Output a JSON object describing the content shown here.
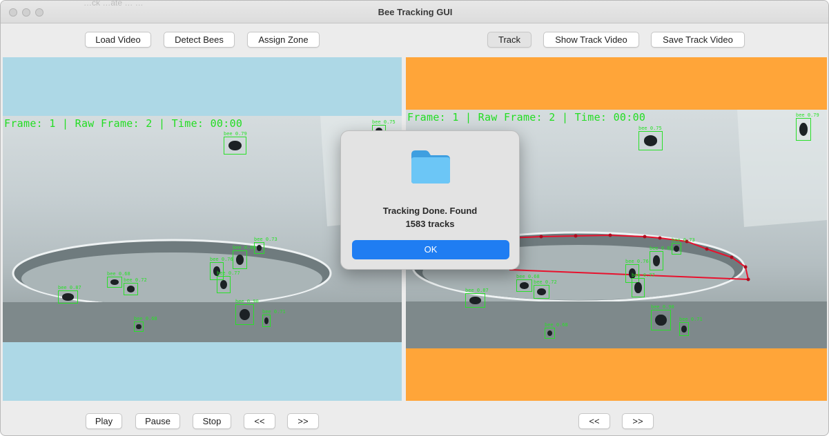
{
  "window": {
    "title": "Bee Tracking GUI",
    "background_text": "…ck                                                      …ate … …"
  },
  "toolbar": {
    "load_video": "Load Video",
    "detect_bees": "Detect Bees",
    "assign_zone": "Assign Zone",
    "track": "Track",
    "show_track_video": "Show Track Video",
    "save_track_video": "Save Track Video"
  },
  "left_panel": {
    "background_color": "#add8e6",
    "overlay": "Frame: 1  |  Raw Frame: 2  |  Time: 00:00",
    "detections": [
      {
        "label": "bee 0.75"
      },
      {
        "label": "bee 0.79"
      },
      {
        "label": "bee 0.73"
      },
      {
        "label": "bee 0.89"
      },
      {
        "label": "bee 0.76"
      },
      {
        "label": "bee 0.77"
      },
      {
        "label": "bee 0.68"
      },
      {
        "label": "bee 0.72"
      },
      {
        "label": "bee 0.87"
      },
      {
        "label": "bee 0.90"
      },
      {
        "label": "bee 0.71"
      },
      {
        "label": "bee 0.68"
      }
    ]
  },
  "right_panel": {
    "background_color": "#ffa539",
    "overlay": "Frame: 1  |  Raw Frame: 2  |  Time: 00:00",
    "detections": [
      {
        "label": "bee 0.79"
      },
      {
        "label": "bee 0.75"
      },
      {
        "label": "bee 0.89"
      },
      {
        "label": "bee 0.73"
      },
      {
        "label": "bee 0.76"
      },
      {
        "label": "bee 0.77"
      },
      {
        "label": "bee 0.68"
      },
      {
        "label": "bee 0.72"
      },
      {
        "label": "bee 0.87"
      },
      {
        "label": "bee 0.90"
      },
      {
        "label": "bee 0.71"
      },
      {
        "label": "bee 0.68"
      }
    ],
    "zone_color": "#e8112d"
  },
  "dialog": {
    "icon": "folder-icon",
    "message_line1": "Tracking Done. Found",
    "message_line2": "1583 tracks",
    "ok_label": "OK",
    "button_color": "#1f7df2"
  },
  "playback": {
    "play": "Play",
    "pause": "Pause",
    "stop": "Stop",
    "prev": "<<",
    "next": ">>",
    "right_prev": "<<",
    "right_next": ">>"
  }
}
